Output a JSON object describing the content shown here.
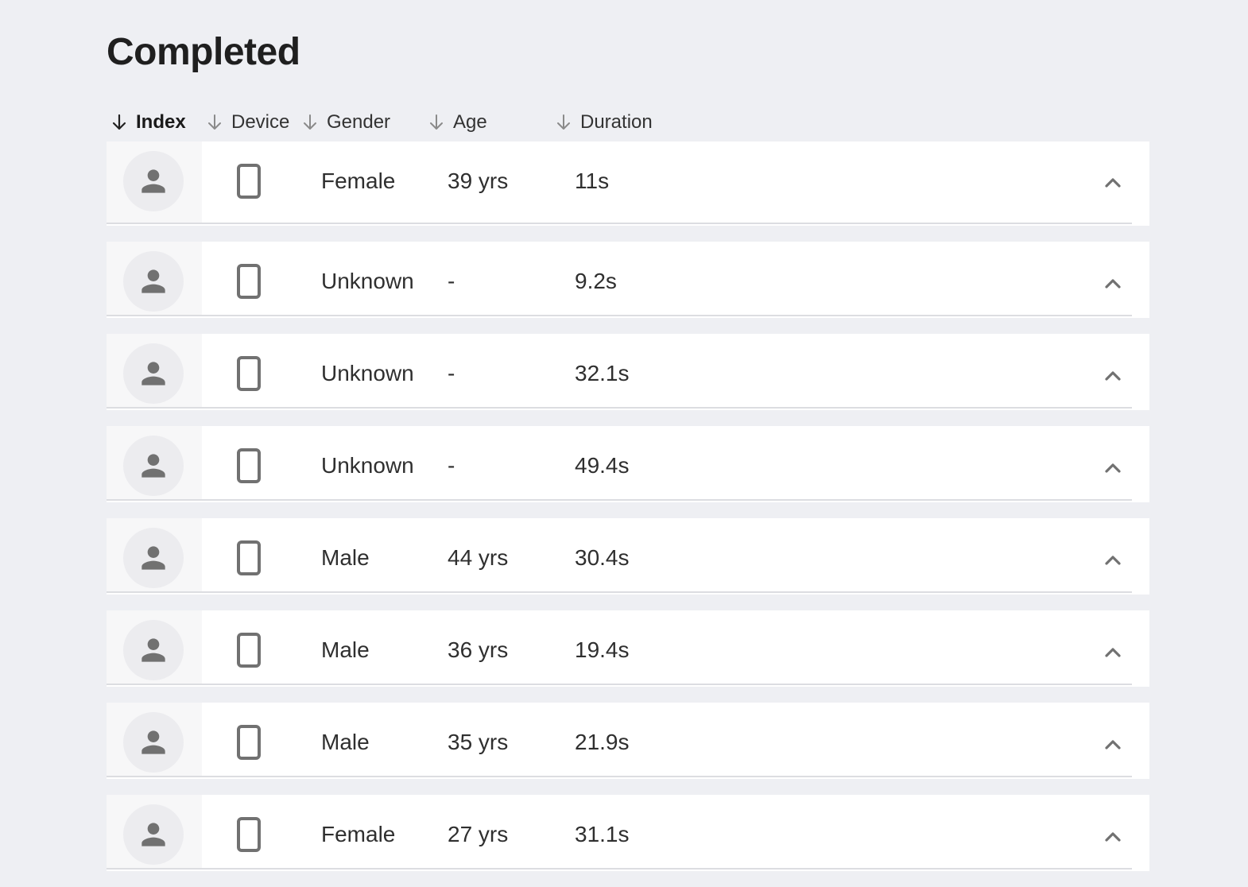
{
  "page": {
    "title": "Completed"
  },
  "columns": {
    "index": "Index",
    "device": "Device",
    "gender": "Gender",
    "age": "Age",
    "duration": "Duration",
    "active_sort": "index",
    "sort_direction": "descending"
  },
  "rows": [
    {
      "gender": "Female",
      "age": "39 yrs",
      "duration": "11s",
      "device_icon": "phone-icon",
      "avatar_icon": "person-icon"
    },
    {
      "gender": "Unknown",
      "age": "-",
      "duration": "9.2s",
      "device_icon": "phone-icon",
      "avatar_icon": "person-icon"
    },
    {
      "gender": "Unknown",
      "age": "-",
      "duration": "32.1s",
      "device_icon": "phone-icon",
      "avatar_icon": "person-icon"
    },
    {
      "gender": "Unknown",
      "age": "-",
      "duration": "49.4s",
      "device_icon": "phone-icon",
      "avatar_icon": "person-icon"
    },
    {
      "gender": "Male",
      "age": "44 yrs",
      "duration": "30.4s",
      "device_icon": "phone-icon",
      "avatar_icon": "person-icon"
    },
    {
      "gender": "Male",
      "age": "36 yrs",
      "duration": "19.4s",
      "device_icon": "phone-icon",
      "avatar_icon": "person-icon"
    },
    {
      "gender": "Male",
      "age": "35 yrs",
      "duration": "21.9s",
      "device_icon": "phone-icon",
      "avatar_icon": "person-icon"
    },
    {
      "gender": "Female",
      "age": "27 yrs",
      "duration": "31.1s",
      "device_icon": "phone-icon",
      "avatar_icon": "person-icon"
    }
  ],
  "colors": {
    "background": "#eeeff3",
    "row_background": "#ffffff",
    "icon_gray": "#717171",
    "avatar_circle": "#ececef",
    "divider": "#dcdde1"
  }
}
